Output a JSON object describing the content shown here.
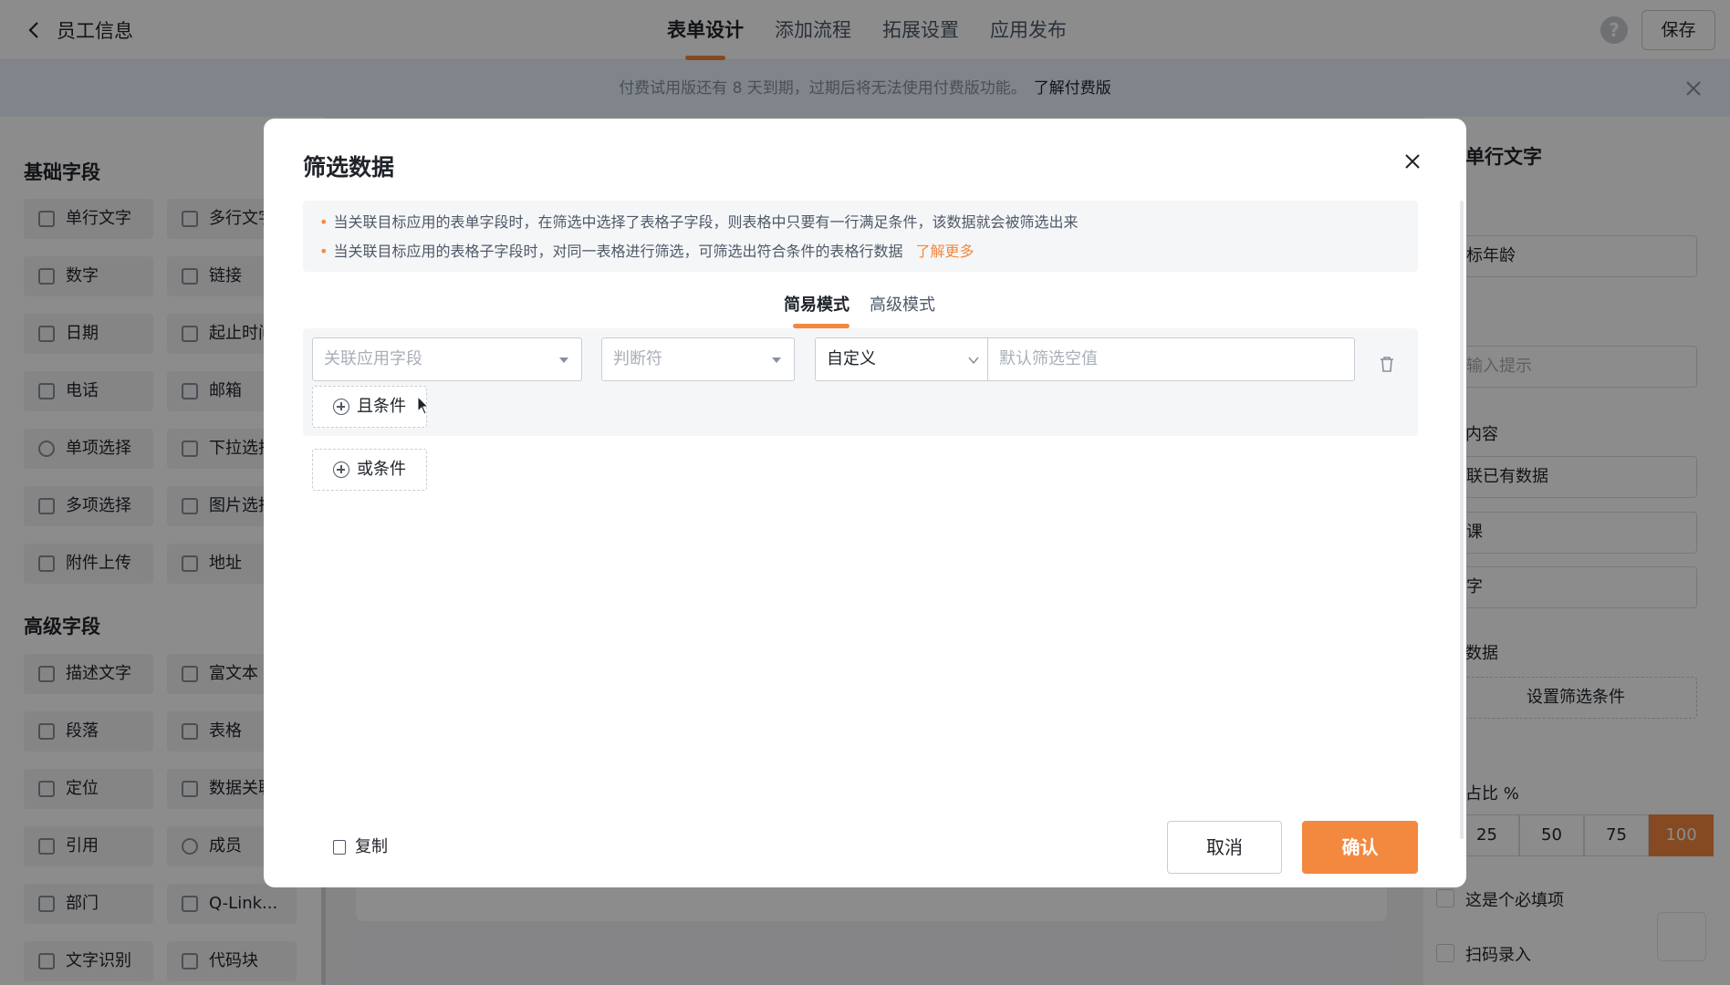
{
  "header": {
    "title": "员工信息",
    "tabs": [
      {
        "label": "表单设计",
        "active": true
      },
      {
        "label": "添加流程",
        "active": false
      },
      {
        "label": "拓展设置",
        "active": false
      },
      {
        "label": "应用发布",
        "active": false
      }
    ],
    "help_label": "?",
    "save_label": "保存"
  },
  "notice": {
    "text": "付费试用版还有 8 天到期，过期后将无法使用付费版功能。",
    "link": "了解付费版"
  },
  "left_panel": {
    "basic_title": "基础字段",
    "basic_fields": [
      "单行文字",
      "多行文字",
      "数字",
      "链接",
      "日期",
      "起止时间",
      "电话",
      "邮箱",
      "单项选择",
      "下拉选择",
      "多项选择",
      "图片选择",
      "附件上传",
      "地址"
    ],
    "advanced_title": "高级字段",
    "advanced_fields": [
      "描述文字",
      "富文本",
      "段落",
      "表格",
      "定位",
      "数据关联",
      "引用",
      "成员",
      "部门",
      "Q-Link...",
      "文字识别",
      "代码块"
    ]
  },
  "right_panel": {
    "title": "单行文字",
    "title_field_value": "标年龄",
    "hint_placeholder": "输入提示",
    "content_label": "内容",
    "select_1": "联已有数据",
    "select_2": "课",
    "select_3": "字",
    "filter_label": "数据",
    "filter_button": "设置筛选条件",
    "width_label": "占比 %",
    "width_options": [
      "25",
      "50",
      "75",
      "100"
    ],
    "width_selected": "100",
    "required_label": "这是个必填项",
    "scan_label": "扫码录入"
  },
  "modal": {
    "title": "筛选数据",
    "tips": [
      "当关联目标应用的表单字段时，在筛选中选择了表格子字段，则表格中只要有一行满足条件，该数据就会被筛选出来",
      "当关联目标应用的表格子字段时，对同一表格进行筛选，可筛选出符合条件的表格行数据"
    ],
    "learn_more": "了解更多",
    "modes": [
      {
        "label": "简易模式",
        "active": true
      },
      {
        "label": "高级模式",
        "active": false
      }
    ],
    "condition": {
      "field_placeholder": "关联应用字段",
      "operator_placeholder": "判断符",
      "value_type": "自定义",
      "value_placeholder": "默认筛选空值"
    },
    "and_condition": "且条件",
    "or_condition": "或条件",
    "copy": "复制",
    "cancel": "取消",
    "confirm": "确认"
  },
  "colors": {
    "accent": "#f3883f",
    "overlay": "rgba(0,0,0,0.45)"
  }
}
